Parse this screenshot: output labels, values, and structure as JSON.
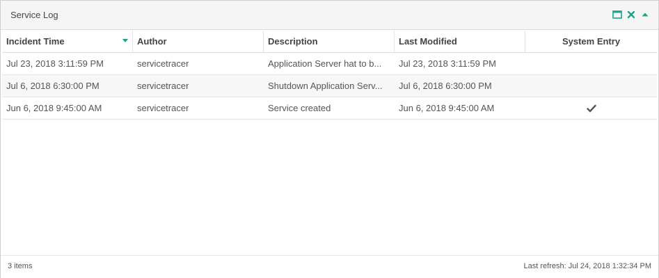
{
  "panel": {
    "title": "Service Log"
  },
  "colors": {
    "accent": "#1aa38a",
    "check": "#555555"
  },
  "grid": {
    "columns": [
      {
        "label": "Incident Time",
        "sorted": "desc"
      },
      {
        "label": "Author"
      },
      {
        "label": "Description"
      },
      {
        "label": "Last Modified"
      },
      {
        "label": "System Entry"
      }
    ],
    "rows": [
      {
        "incident_time": "Jul 23, 2018 3:11:59 PM",
        "author": "servicetracer",
        "description": "Application Server hat to b...",
        "last_modified": "Jul 23, 2018 3:11:59 PM",
        "system_entry": false
      },
      {
        "incident_time": "Jul 6, 2018 6:30:00 PM",
        "author": "servicetracer",
        "description": "Shutdown Application Serv...",
        "last_modified": "Jul 6, 2018 6:30:00 PM",
        "system_entry": false
      },
      {
        "incident_time": "Jun 6, 2018 9:45:00 AM",
        "author": "servicetracer",
        "description": "Service created",
        "last_modified": "Jun 6, 2018 9:45:00 AM",
        "system_entry": true
      }
    ]
  },
  "footer": {
    "items_count": "3 items",
    "last_refresh": "Last refresh: Jul 24, 2018 1:32:34 PM"
  },
  "icons": {
    "maximize": "maximize-icon",
    "close": "close-icon",
    "collapse": "collapse-icon",
    "sort": "sort-desc-icon",
    "check": "checkmark-icon"
  }
}
